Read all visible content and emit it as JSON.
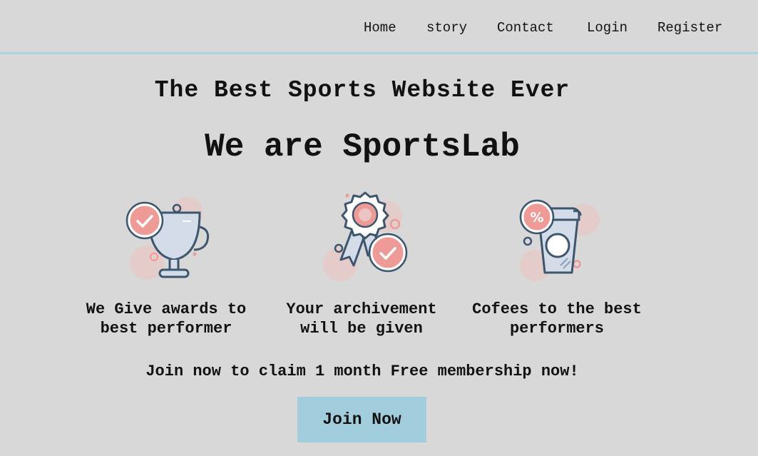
{
  "nav": {
    "items": [
      {
        "label": "Home"
      },
      {
        "label": "story"
      },
      {
        "label": "Contact"
      },
      {
        "label": "Login"
      },
      {
        "label": "Register"
      }
    ]
  },
  "hero": {
    "tagline": "The Best Sports Website Ever",
    "headline": "We are SportsLab"
  },
  "features": [
    {
      "icon": "trophy-icon",
      "line1": "We Give awards to",
      "line2": "best performer"
    },
    {
      "icon": "award-ribbon-icon",
      "line1": "Your archivement",
      "line2": "will be given"
    },
    {
      "icon": "coffee-cup-icon",
      "line1": "Cofees to the best",
      "line2": "performers"
    }
  ],
  "promo": {
    "text": "Join now to claim 1 month Free membership now!",
    "button_label": "Join Now"
  },
  "colors": {
    "background": "#d8d8d8",
    "nav_border": "#a9d4e4",
    "button": "#a2cddd",
    "icon_accent": "#ee9a96",
    "icon_fill": "#d3dce8",
    "icon_stroke": "#3d566e"
  }
}
